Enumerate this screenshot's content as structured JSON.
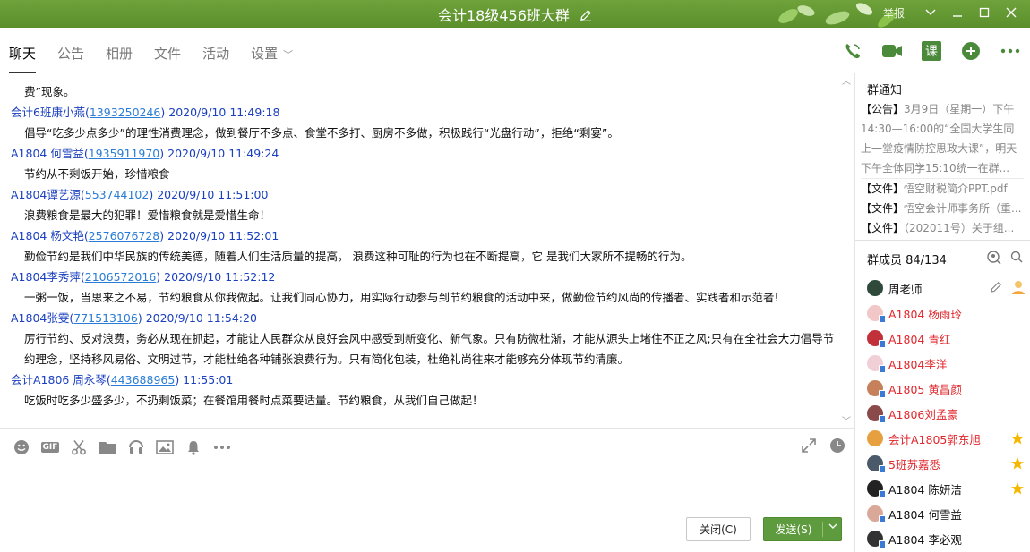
{
  "window": {
    "title": "会计18级456班大群",
    "report": "举报",
    "accent": "#5e9a3e",
    "icons": [
      "edit-icon",
      "chevron-down-icon",
      "minimize-icon",
      "maximize-icon",
      "close-icon"
    ]
  },
  "tabs": [
    {
      "label": "聊天",
      "active": true
    },
    {
      "label": "公告"
    },
    {
      "label": "相册"
    },
    {
      "label": "文件"
    },
    {
      "label": "活动"
    },
    {
      "label": "设置"
    }
  ],
  "tools": {
    "ke_label": "课",
    "icons": [
      "phone-icon",
      "video-icon",
      "class-icon",
      "add-icon",
      "more-icon"
    ]
  },
  "messages": [
    {
      "head": "",
      "qq": "",
      "time": "",
      "body": "费”现象。"
    },
    {
      "head": "会计6班康小燕",
      "qq": "1393250246",
      "time": "2020/9/10 11:49:18",
      "body": "倡导“吃多少点多少”的理性消费理念，做到餐厅不多点、食堂不多打、厨房不多做，积极践行“光盘行动”，拒绝“剩宴”。"
    },
    {
      "head": "A1804  何雪益",
      "qq": "1935911970",
      "time": "2020/9/10 11:49:24",
      "body": "节约从不剩饭开始，珍惜粮食"
    },
    {
      "head": "A1804谭艺源",
      "qq": "553744102",
      "time": "2020/9/10 11:51:00",
      "body": "浪费粮食是最大的犯罪！爱惜粮食就是爱惜生命！"
    },
    {
      "head": "A1804 杨文艳",
      "qq": "2576076728",
      "time": "2020/9/10 11:52:01",
      "body": "勤俭节约是我们中华民族的传统美德，随着人们生活质量的提高，  浪费这种可耻的行为也在不断提高，它  是我们大家所不提畅的行为。"
    },
    {
      "head": "A1804李秀萍",
      "qq": "2106572016",
      "time": "2020/9/10 11:52:12",
      "body": "一粥一饭，当思来之不易，节约粮食从你我做起。让我们同心协力，用实际行动参与到节约粮食的活动中来，做勤俭节约风尚的传播者、实践者和示范者!"
    },
    {
      "head": "A1804张雯",
      "qq": "771513106",
      "time": "2020/9/10 11:54:20",
      "body": "厉行节约、反对浪费，务必从现在抓起，才能让人民群众从良好会风中感受到新变化、新气象。只有防微杜渐，才能从源头上堵住不正之风;只有在全社会大力倡导节约理念，坚持移风易俗、文明过节，才能杜绝各种铺张浪费行为。只有简化包装，杜绝礼尚往来才能够充分体现节约清廉。"
    },
    {
      "head": "会计A1806 周永琴",
      "qq": "443688965",
      "time": " 11:55:01",
      "body": "吃饭时吃多少盛多少，不扔剩饭菜；在餐馆用餐时点菜要适量。节约粮食，从我们自己做起！"
    }
  ],
  "input_toolbar": {
    "icons": [
      "emoji-icon",
      "gif-icon",
      "scissors-icon",
      "folder-icon",
      "music-icon",
      "image-icon",
      "bell-icon",
      "more-icon"
    ],
    "gif_label": "GIF",
    "right_icons": [
      "expand-icon",
      "clock-icon"
    ]
  },
  "buttons": {
    "close": "关闭(C)",
    "send": "发送(S)"
  },
  "notice": {
    "title": "群通知",
    "tag": "【公告】",
    "text": "3月9日（星期一）下午14:30—16:00的“全国大学生同上一堂疫情防控思政大课”，明天下午全体同学15:10统一在群..."
  },
  "files": [
    {
      "tag": "【文件】",
      "name": "悟空财税简介PPT.pdf"
    },
    {
      "tag": "【文件】",
      "name": "悟空会计师事务所（重..."
    },
    {
      "tag": "【文件】",
      "name": "（202011号）关于组..."
    }
  ],
  "members": {
    "title": "群成员 84/134",
    "list": [
      {
        "name": "周老师",
        "color": "black",
        "avatar": "#2f4a3a",
        "extra": "owner"
      },
      {
        "name": "A1804    杨雨玲",
        "color": "red",
        "avatar": "#f2c7c7",
        "device": true
      },
      {
        "name": "A1804 青红",
        "color": "red",
        "avatar": "#c2303a",
        "device": true
      },
      {
        "name": "A1804李洋",
        "color": "red",
        "avatar": "#f0d0d6",
        "device": true
      },
      {
        "name": "A1805 黄昌颜",
        "color": "red",
        "avatar": "#c6805a",
        "device": true
      },
      {
        "name": "A1806刘孟豪",
        "color": "red",
        "avatar": "#8a4a4a",
        "device": true
      },
      {
        "name": "会计A1805郭东旭",
        "color": "red",
        "avatar": "#e6a040",
        "star": true
      },
      {
        "name": "5班苏嘉悉",
        "color": "red",
        "avatar": "#4a5a6a",
        "device": true,
        "star": true
      },
      {
        "name": "A1804     陈妍洁",
        "color": "black",
        "avatar": "#222222",
        "device": true,
        "star": true
      },
      {
        "name": "A1804  何雪益",
        "color": "black",
        "avatar": "#d9a898",
        "device": true
      },
      {
        "name": "A1804  李必观",
        "color": "black",
        "avatar": "#333333",
        "device": true
      }
    ]
  }
}
